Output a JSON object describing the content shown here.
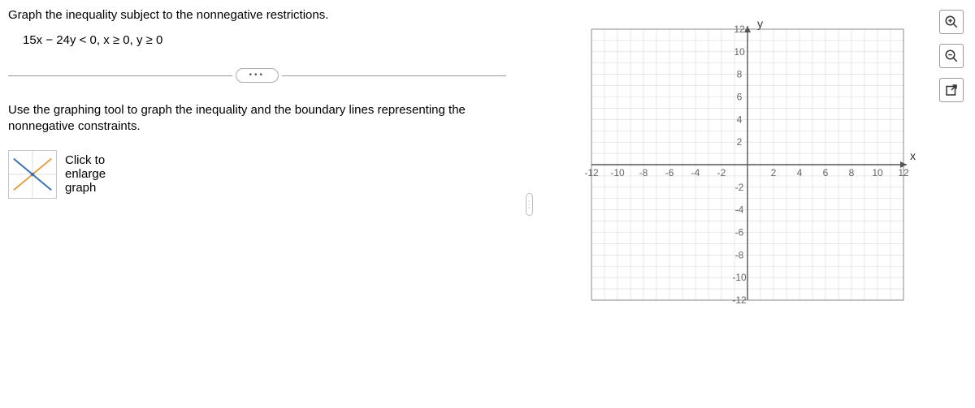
{
  "question": {
    "title": "Graph the inequality subject to the nonnegative restrictions.",
    "inequality": "15x − 24y < 0, x ≥ 0, y ≥ 0"
  },
  "instruction": "Use the graphing tool to graph the inequality and the boundary lines representing the nonnegative constraints.",
  "graphButton": {
    "line1": "Click to",
    "line2": "enlarge",
    "line3": "graph"
  },
  "chart_data": {
    "type": "scatter",
    "series": [],
    "xlim": [
      -12,
      12
    ],
    "ylim": [
      -12,
      12
    ],
    "xlabel": "x",
    "ylabel": "y",
    "xticks": [
      -12,
      -10,
      -8,
      -6,
      -4,
      -2,
      2,
      4,
      6,
      8,
      10,
      12
    ],
    "yticks": [
      -12,
      -10,
      -8,
      -6,
      -4,
      -2,
      2,
      4,
      6,
      8,
      10,
      12
    ],
    "grid": true,
    "title": ""
  },
  "tools": {
    "zoom_in": "zoom-in",
    "zoom_out": "zoom-out",
    "popout": "popout"
  }
}
